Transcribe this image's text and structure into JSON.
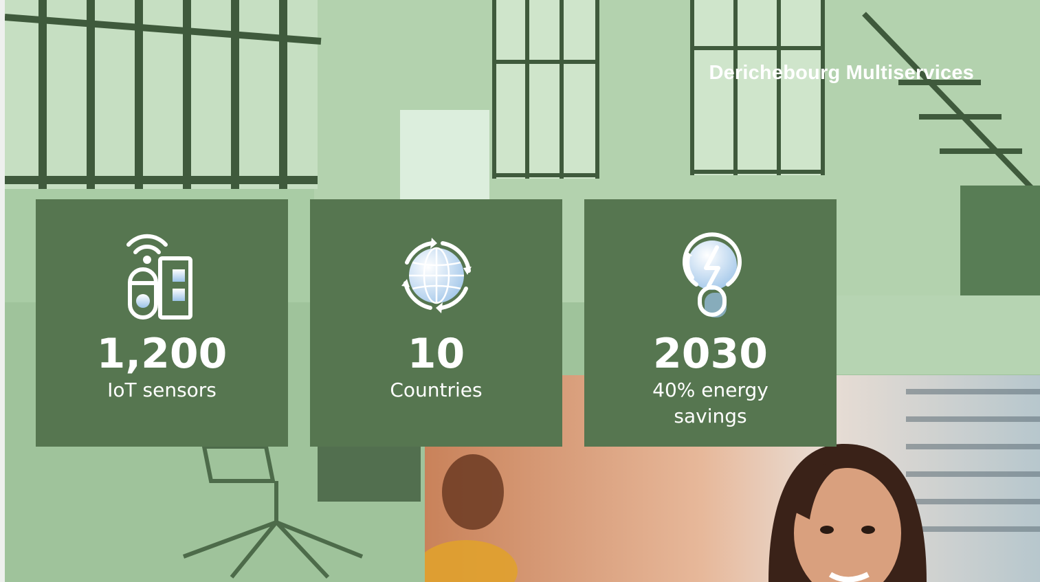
{
  "header": {
    "brand": "Derichebourg Multiservices"
  },
  "stats": [
    {
      "value": "1,200",
      "label": "IoT sensors",
      "icon": "iot-sensor-icon"
    },
    {
      "value": "10",
      "label": "Countries",
      "icon": "globe-cycle-icon"
    },
    {
      "value": "2030",
      "label": "40% energy savings",
      "icon": "energy-bulb-icon"
    }
  ],
  "colors": {
    "card_background": "#567650",
    "photo_tint": "#9ec49a",
    "text": "#ffffff"
  }
}
